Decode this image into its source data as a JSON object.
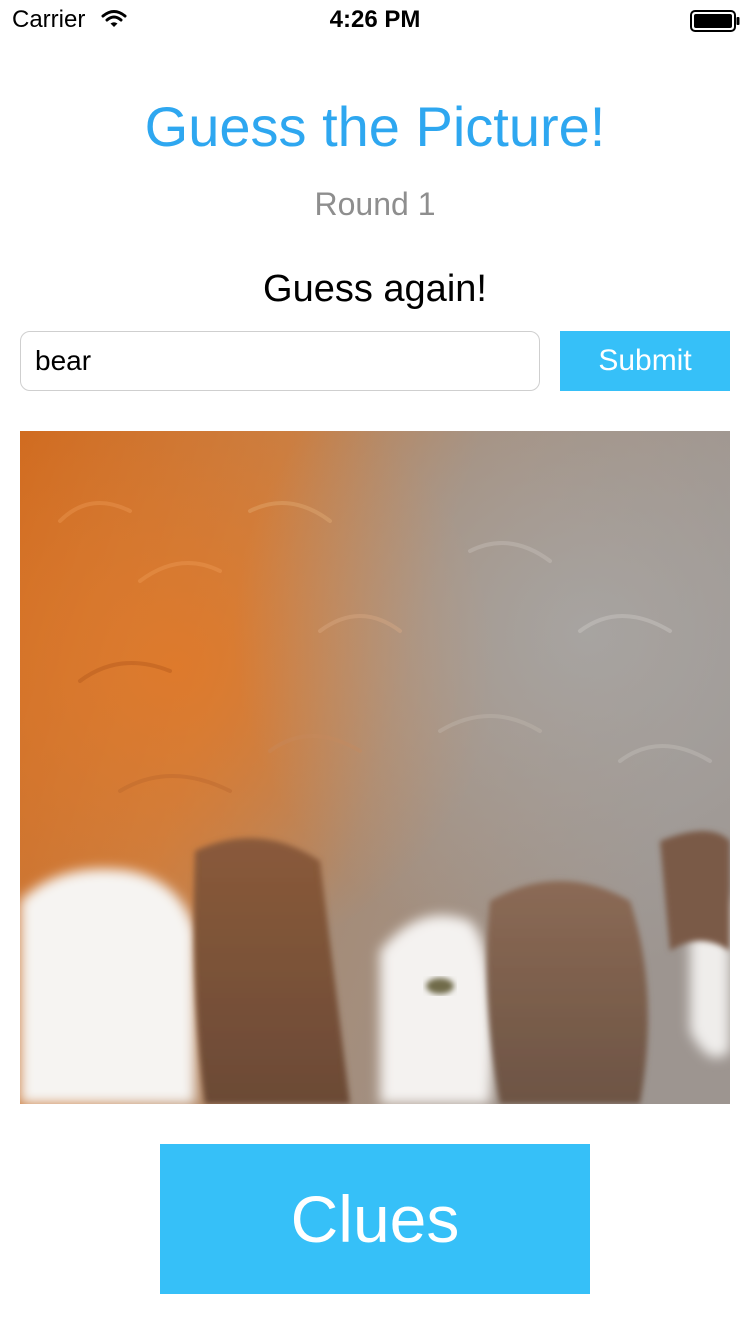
{
  "status_bar": {
    "carrier": "Carrier",
    "time": "4:26 PM",
    "wifi_icon": "wifi-icon",
    "battery_icon": "battery-full-icon"
  },
  "header": {
    "title": "Guess the Picture!",
    "round": "Round 1"
  },
  "feedback": "Guess again!",
  "guess": {
    "value": "bear",
    "submit_label": "Submit"
  },
  "puzzle": {
    "image": "zoomed-in animal fur photo"
  },
  "clues": {
    "label": "Clues"
  },
  "colors": {
    "title": "#2ea7f0",
    "button": "#36c0f8",
    "round_text": "#8e8e8e"
  }
}
